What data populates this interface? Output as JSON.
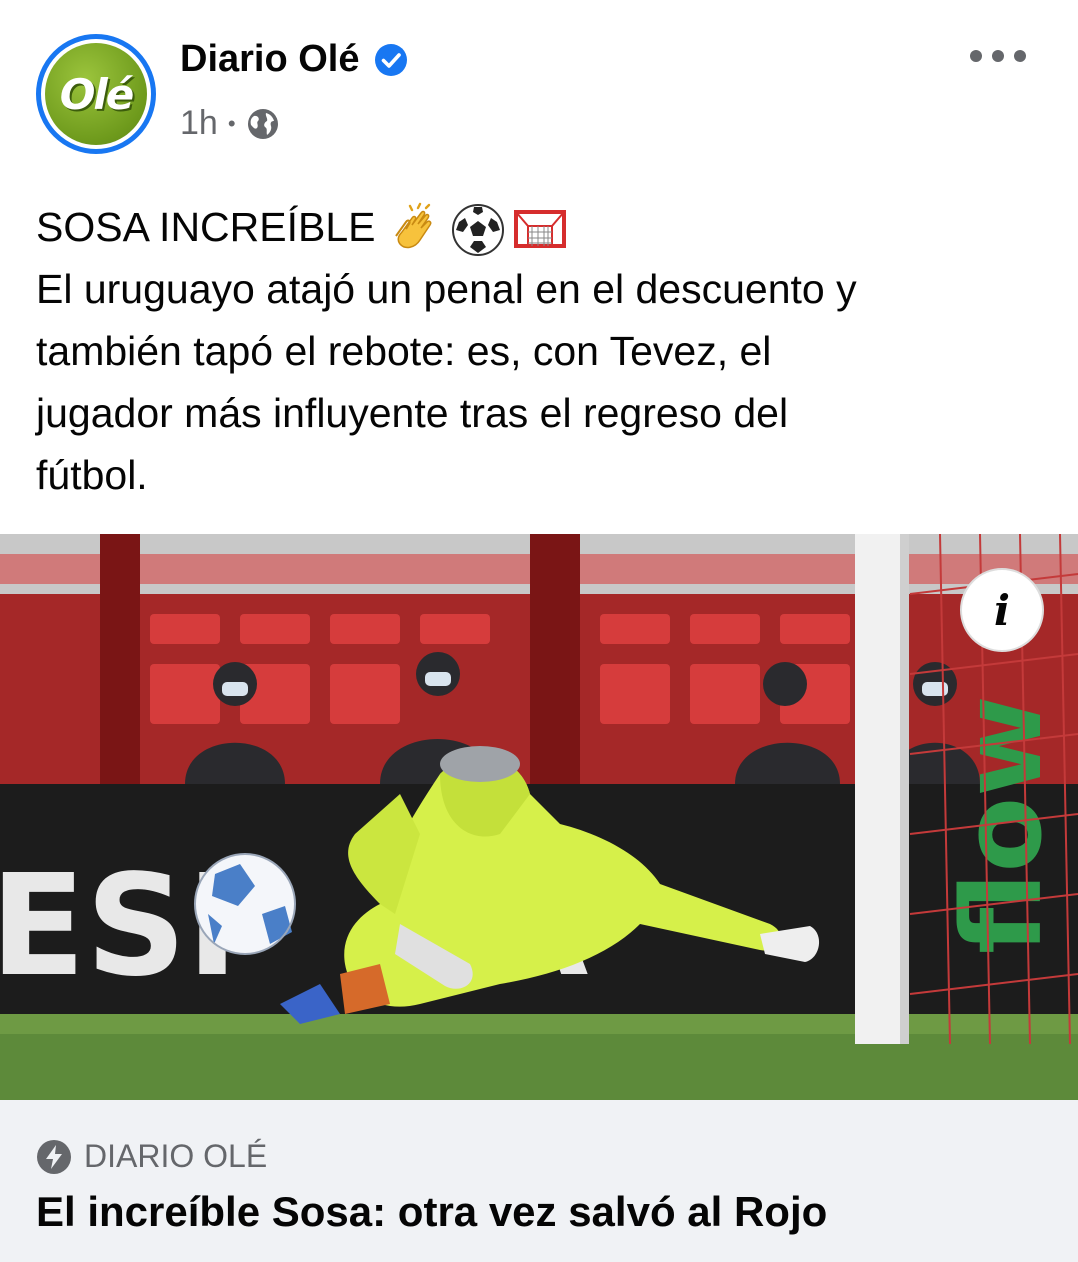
{
  "post": {
    "page_name": "Diario Olé",
    "avatar_text": "Olé",
    "timestamp": "1h",
    "separator": "•",
    "headline": "SOSA INCREÍBLE",
    "headline_emojis": [
      "clapping-hands",
      "soccer-ball",
      "goal-net"
    ],
    "body_lines": [
      "El uruguayo atajó un penal en el descuento y",
      "también tapó el rebote: es, con Tevez, el",
      "jugador más influyente tras el regreso del",
      "fútbol."
    ]
  },
  "link_card": {
    "domain": "DIARIO OLÉ",
    "title": "El increíble Sosa: otra vez salvó al Rojo"
  },
  "colors": {
    "verified_blue": "#1877f2",
    "secondary_text": "#65676b",
    "card_bg": "#f0f2f5",
    "olé_green": "#7ba428"
  },
  "icons": [
    "verified-badge-icon",
    "globe-icon",
    "more-options-icon",
    "info-icon",
    "lightning-bolt-icon"
  ]
}
